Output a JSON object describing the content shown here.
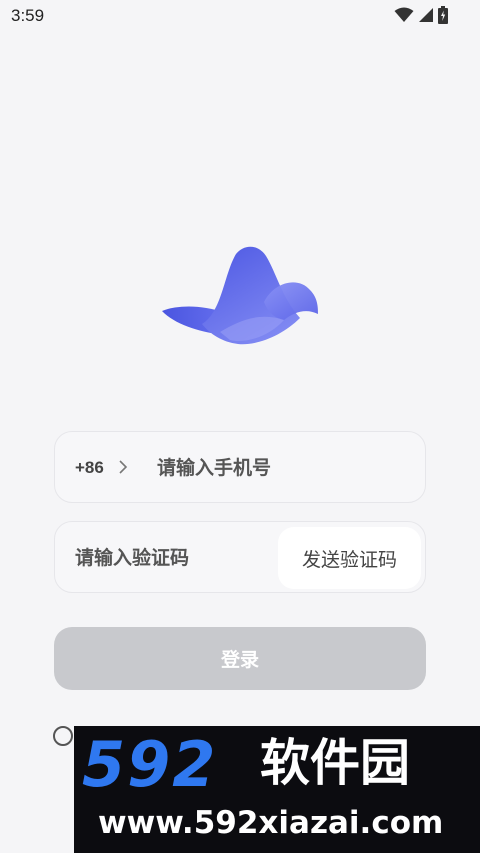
{
  "status_bar": {
    "time": "3:59",
    "icons": [
      "wifi-icon",
      "signal-icon",
      "battery-charging-icon"
    ]
  },
  "logo": {
    "name": "bird-logo",
    "colors": {
      "primary": "#5560e6",
      "light": "#8b94f4"
    }
  },
  "phone_field": {
    "country_code": "+86",
    "chevron": "chevron-right-icon",
    "placeholder": "请输入手机号",
    "value": ""
  },
  "code_field": {
    "placeholder": "请输入验证码",
    "value": "",
    "send_code_label": "发送验证码"
  },
  "login_button": {
    "label": "登录",
    "color": "#c8c9cd"
  },
  "agreement": {
    "checked": false
  },
  "watermark": {
    "number": "592",
    "name": "软件园",
    "url": "www.592xiazai.com"
  }
}
